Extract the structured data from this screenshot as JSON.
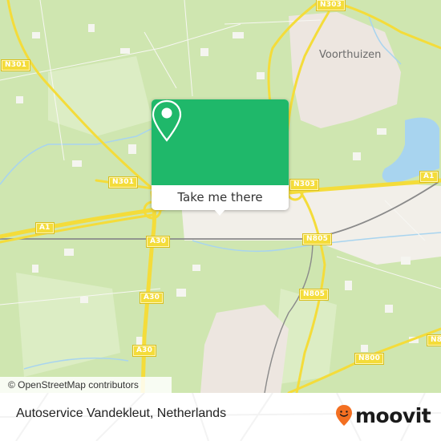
{
  "map": {
    "town_labels": [
      "Voorthuizen"
    ],
    "road_labels": {
      "n303_top": "N303",
      "n301_left": "N301",
      "n301_mid": "N301",
      "n303_mid": "N303",
      "a1_right": "A1",
      "a1_left": "A1",
      "a30_1": "A30",
      "a30_2": "A30",
      "a30_3": "A30",
      "n805_1": "N805",
      "n805_2": "N805",
      "n800_1": "N800",
      "n800_2": "N8"
    },
    "attribution": "© OpenStreetMap contributors",
    "colors": {
      "forest": "#cfe6b0",
      "urban": "#ede6e0",
      "water": "#a8d4ef",
      "road": "#f4dc3a",
      "accent": "#1fb86a"
    }
  },
  "popup": {
    "icon": "map-pin-icon",
    "button_label": "Take me there"
  },
  "footer": {
    "place_name": "Autoservice Vandekleut, Netherlands",
    "brand": "moovit",
    "brand_color": "#f36f21"
  }
}
